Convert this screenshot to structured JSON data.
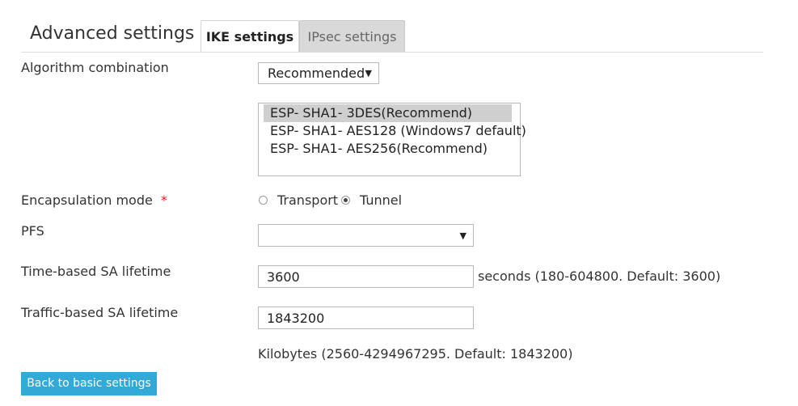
{
  "header": {
    "title": "Advanced settings",
    "tabs": [
      {
        "label": "IKE settings",
        "active": true
      },
      {
        "label": "IPsec settings",
        "active": false
      }
    ]
  },
  "algorithm": {
    "label": "Algorithm combination",
    "selected": "Recommended",
    "options": [
      {
        "label": "ESP- SHA1- 3DES(Recommend)",
        "selected": true
      },
      {
        "label": "ESP- SHA1- AES128 (Windows7 default)",
        "selected": false
      },
      {
        "label": "ESP- SHA1- AES256(Recommend)",
        "selected": false
      }
    ]
  },
  "encapsulation": {
    "label": "Encapsulation mode",
    "required_mark": "*",
    "options": [
      {
        "label": "Transport",
        "checked": false
      },
      {
        "label": "Tunnel",
        "checked": true
      }
    ]
  },
  "pfs": {
    "label": "PFS",
    "value": ""
  },
  "time_sa": {
    "label": "Time-based SA lifetime",
    "value": "3600",
    "hint": "seconds (180-604800. Default: 3600)"
  },
  "traffic_sa": {
    "label": "Traffic-based SA lifetime",
    "value": "1843200",
    "hint": "Kilobytes (2560-4294967295. Default: 1843200)"
  },
  "actions": {
    "back_label": "Back to basic settings"
  },
  "colors": {
    "button_bg": "#32a9d6",
    "required": "#e02020",
    "inactive_tab": "#d9d9d9"
  }
}
